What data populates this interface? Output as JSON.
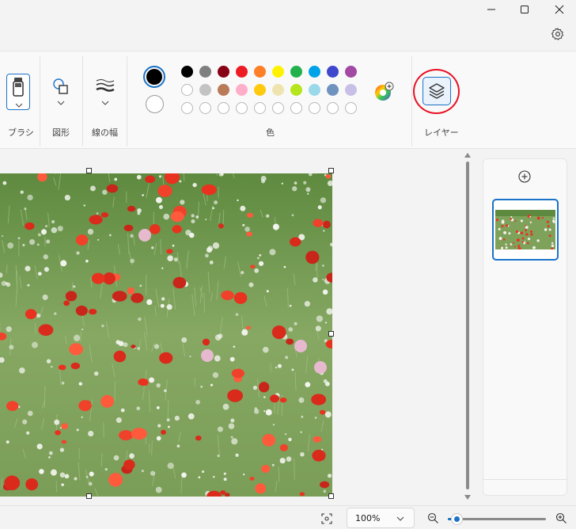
{
  "titlebar": {
    "minimize_icon": "minimize-icon",
    "maximize_icon": "maximize-icon",
    "close_icon": "close-icon",
    "settings_icon": "gear-icon"
  },
  "ribbon": {
    "brush_label": "ブラシ",
    "shapes_label": "図形",
    "stroke_label": "線の幅",
    "colors_label": "色",
    "layers_label": "レイヤー"
  },
  "palette": {
    "primary": "#000000",
    "secondary": "#ffffff",
    "row1": [
      "#000000",
      "#7f7f7f",
      "#880015",
      "#ed1c24",
      "#ff7f27",
      "#fff200",
      "#22b14c",
      "#00a2e8",
      "#3f48cc",
      "#a349a4"
    ],
    "row2": [
      "#ffffff",
      "#c3c3c3",
      "#b97a57",
      "#ffaec9",
      "#ffc90e",
      "#efe4b0",
      "#b5e61d",
      "#99d9ea",
      "#7092be",
      "#c8bfe7"
    ],
    "row3": [
      "",
      "",
      "",
      "",
      "",
      "",
      "",
      "",
      "",
      ""
    ]
  },
  "highlight_color": "#e81123",
  "statusbar": {
    "zoom": "100%",
    "zoom_level": 0.1
  }
}
